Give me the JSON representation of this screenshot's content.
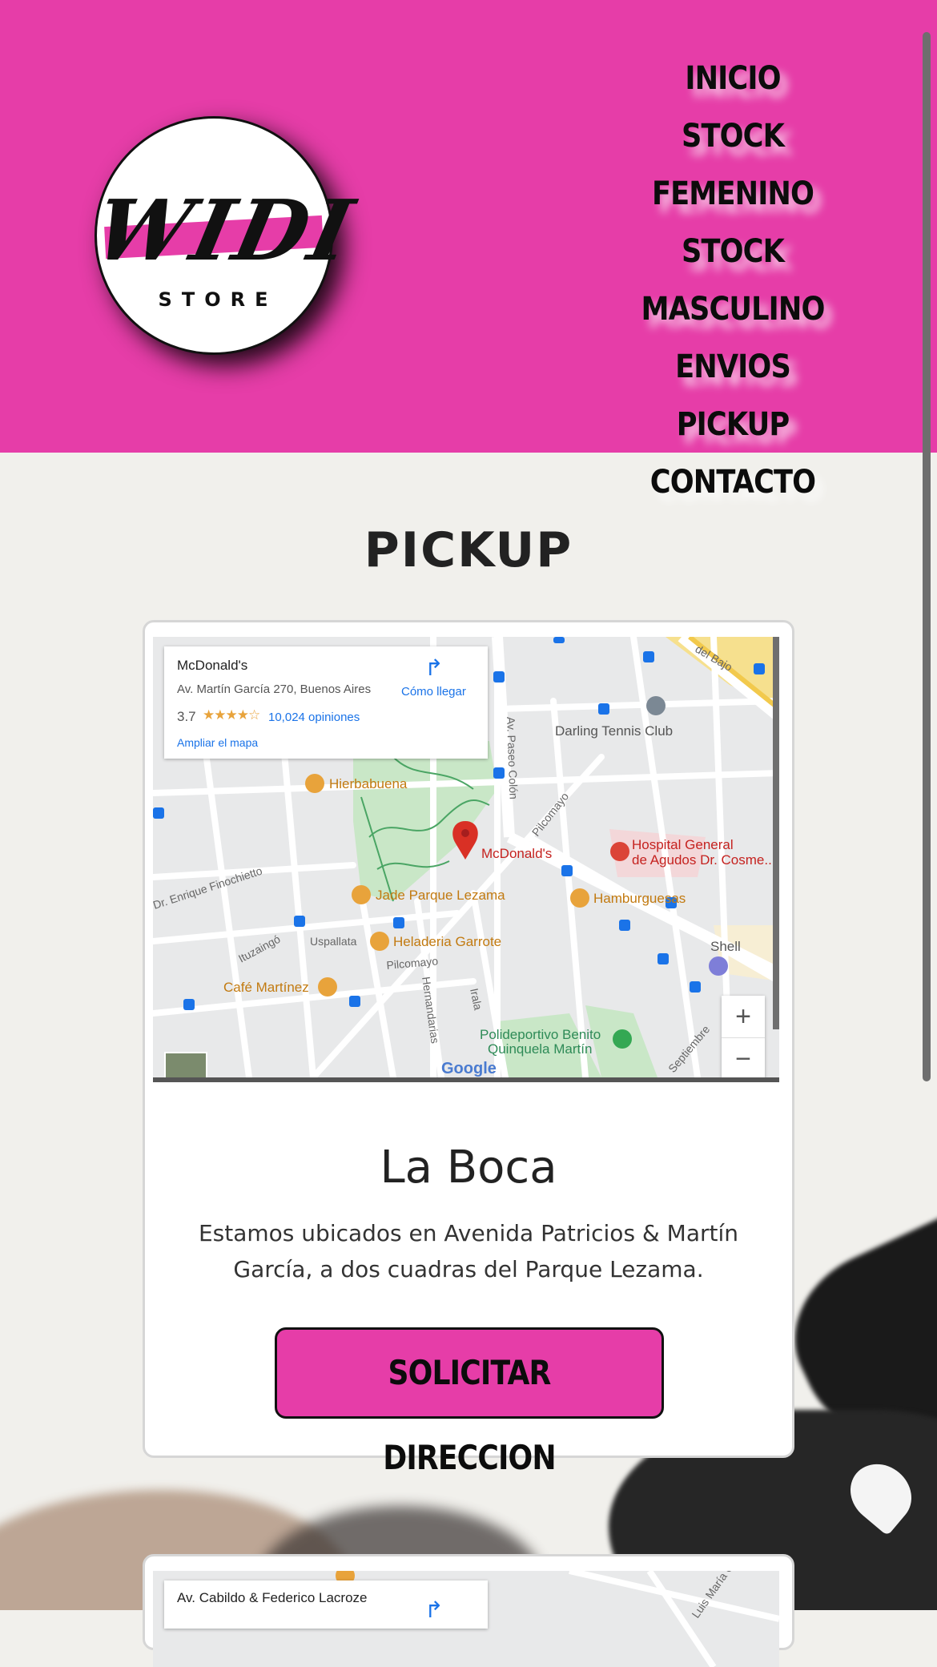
{
  "brand": {
    "logo_word": "WIDI",
    "logo_sub": "STORE",
    "accent": "#e63da8"
  },
  "nav": {
    "items": [
      "INICIO",
      "STOCK FEMENINO",
      "STOCK MASCULINO",
      "ENVIOS",
      "PICKUP",
      "CONTACTO"
    ]
  },
  "page": {
    "title": "PICKUP"
  },
  "locations": [
    {
      "map": {
        "place": "McDonald's",
        "address": "Av. Martín García 270, Buenos Aires",
        "rating": "3.7",
        "stars": "★★★★☆",
        "reviews": "10,024 opiniones",
        "expand": "Ampliar el mapa",
        "directions": "Cómo llegar",
        "zoom_in": "+",
        "zoom_out": "−",
        "attribution": "Google",
        "labels": {
          "hierbabuena": "Hierbabuena",
          "mcdonalds": "McDonald's",
          "hospital1": "Hospital General",
          "hospital2": "de Agudos Dr. Cosme...",
          "jade": "Jade Parque Lezama",
          "hamburguesas": "Hamburguesas",
          "garrote": "Heladeria Garrote",
          "cafe": "Café Martínez",
          "tennis": "Darling Tennis Club",
          "shell": "Shell",
          "poli1": "Polideportivo Benito",
          "poli2": "Quinquela Martín",
          "paseo_colon": "Av. Paseo Colón",
          "pilcomayo1": "Pilcomayo",
          "pilcomayo2": "Pilcomayo",
          "finochietto": "Dr. Enrique Finochietto",
          "ituzaingo": "Ituzaingó",
          "uspallata": "Uspallata",
          "hernandarias": "Hernandarias",
          "irala": "Irala",
          "del_bajo": "del Bajo",
          "septiembre": "Septiembre"
        }
      },
      "name": "La Boca",
      "description": "Estamos ubicados en Avenida Patricios & Martín García, a dos cuadras del Parque Lezama.",
      "button": "SOLICITAR DIRECCION"
    },
    {
      "map": {
        "place": "Av. Cabildo & Federico Lacroze",
        "directions_icon": "directions-icon",
        "street": "Luis María Campos"
      }
    }
  ]
}
